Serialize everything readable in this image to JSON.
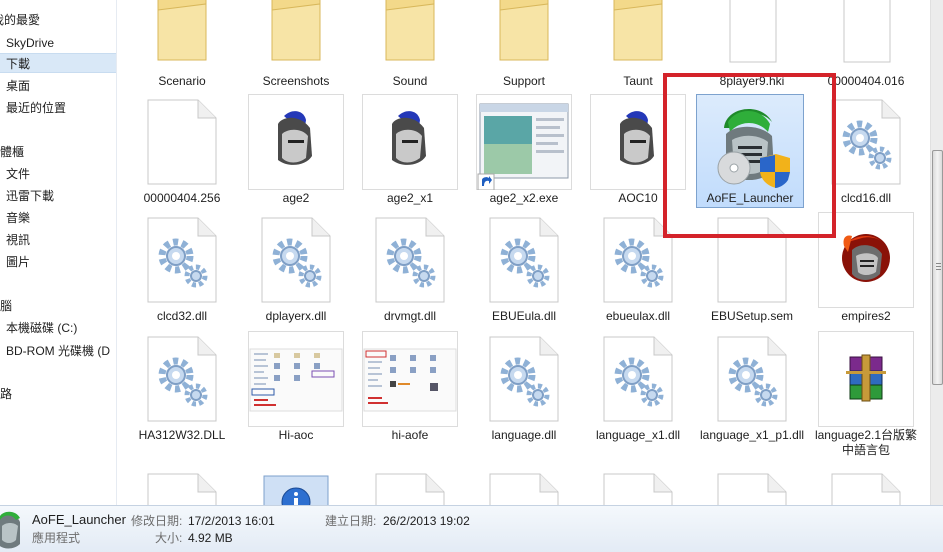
{
  "nav": {
    "items": [
      {
        "label": "我的最愛"
      },
      {
        "label": "SkyDrive"
      },
      {
        "label": "下載"
      },
      {
        "label": "桌面"
      },
      {
        "label": "最近的位置"
      },
      {
        "label": "媒體櫃"
      },
      {
        "label": "文件"
      },
      {
        "label": "迅雷下載"
      },
      {
        "label": "音樂"
      },
      {
        "label": "視訊"
      },
      {
        "label": "圖片"
      },
      {
        "label": "電腦"
      },
      {
        "label": "本機磁碟 (C:)"
      },
      {
        "label": "BD-ROM 光碟機 (D"
      },
      {
        "label": "網路"
      }
    ]
  },
  "files": [
    {
      "name": "Scenario",
      "type": "folder"
    },
    {
      "name": "Screenshots",
      "type": "folder"
    },
    {
      "name": "Sound",
      "type": "folder"
    },
    {
      "name": "Support",
      "type": "folder"
    },
    {
      "name": "Taunt",
      "type": "folder"
    },
    {
      "name": "8player9.hki",
      "type": "file"
    },
    {
      "name": "00000404.016",
      "type": "file"
    },
    {
      "name": "00000404.256",
      "type": "file"
    },
    {
      "name": "age2",
      "type": "helmet"
    },
    {
      "name": "age2_x1",
      "type": "helmet"
    },
    {
      "name": "age2_x2.exe",
      "type": "shortcut"
    },
    {
      "name": "AOC10",
      "type": "helmet"
    },
    {
      "name": "AoFE_Launcher",
      "type": "launcher",
      "selected": true
    },
    {
      "name": "clcd16.dll",
      "type": "dll"
    },
    {
      "name": "clcd32.dll",
      "type": "dll"
    },
    {
      "name": "dplayerx.dll",
      "type": "dll"
    },
    {
      "name": "drvmgt.dll",
      "type": "dll"
    },
    {
      "name": "EBUEula.dll",
      "type": "dll"
    },
    {
      "name": "ebueulax.dll",
      "type": "dll"
    },
    {
      "name": "EBUSetup.sem",
      "type": "file"
    },
    {
      "name": "empires2",
      "type": "empires"
    },
    {
      "name": "HA312W32.DLL",
      "type": "dll"
    },
    {
      "name": "Hi-aoc",
      "type": "image"
    },
    {
      "name": "hi-aofe",
      "type": "image"
    },
    {
      "name": "language.dll",
      "type": "dll"
    },
    {
      "name": "language_x1.dll",
      "type": "dll"
    },
    {
      "name": "language_x1_p1.dll",
      "type": "dll"
    },
    {
      "name": "language2.1台版繁中語言包",
      "type": "archive"
    }
  ],
  "details": {
    "name": "AoFE_Launcher",
    "type": "應用程式",
    "modified_label": "修改日期:",
    "modified": "17/2/2013 16:01",
    "created_label": "建立日期:",
    "created": "26/2/2013 19:02",
    "size_label": "大小:",
    "size": "4.92 MB"
  },
  "colors": {
    "highlight": "#d4232a",
    "selection": "#cde2fb",
    "folder": "#f3d98a"
  }
}
